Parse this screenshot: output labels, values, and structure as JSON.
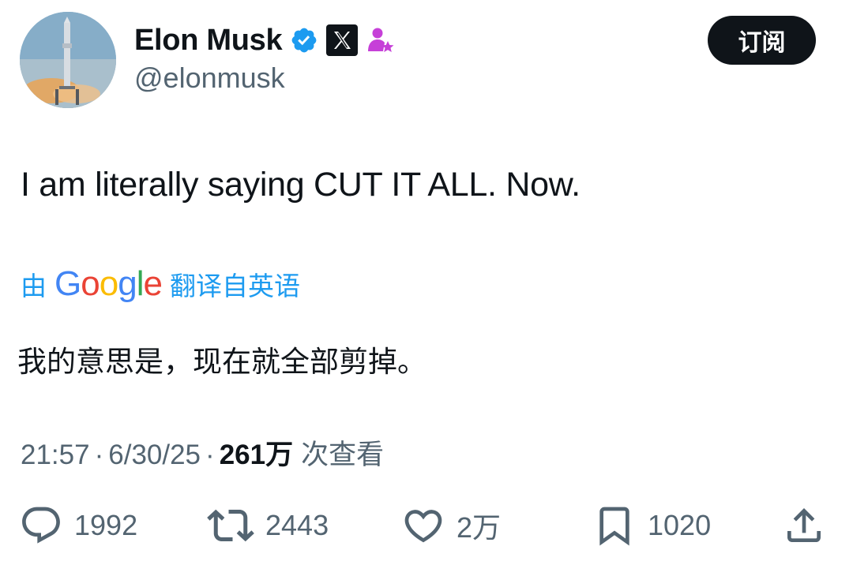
{
  "author": {
    "display_name": "Elon Musk",
    "handle": "@elonmusk",
    "avatar_icon": "rocket-launch-avatar",
    "badges": [
      "verified-badge-icon",
      "x-affiliate-icon",
      "person-star-icon"
    ]
  },
  "header": {
    "subscribe_label": "订阅"
  },
  "tweet": {
    "text": "I am literally saying CUT IT ALL. Now."
  },
  "translation": {
    "prefix": "由",
    "provider_letters": [
      "G",
      "o",
      "o",
      "g",
      "l",
      "e"
    ],
    "suffix": "翻译自英语",
    "translated_text": "我的意思是，现在就全部剪掉。"
  },
  "meta": {
    "time": "21:57",
    "separator": "·",
    "date": "6/30/25",
    "views_count": "261万",
    "views_label": "次查看"
  },
  "actions": {
    "replies": "1992",
    "reposts": "2443",
    "likes": "2万",
    "bookmarks": "1020"
  },
  "colors": {
    "text": "#0f1419",
    "secondary": "#536471",
    "link": "#1d9bf0",
    "verified": "#1d9bf0",
    "button_bg": "#0f1419",
    "affiliate_icon": "#c640d8"
  }
}
